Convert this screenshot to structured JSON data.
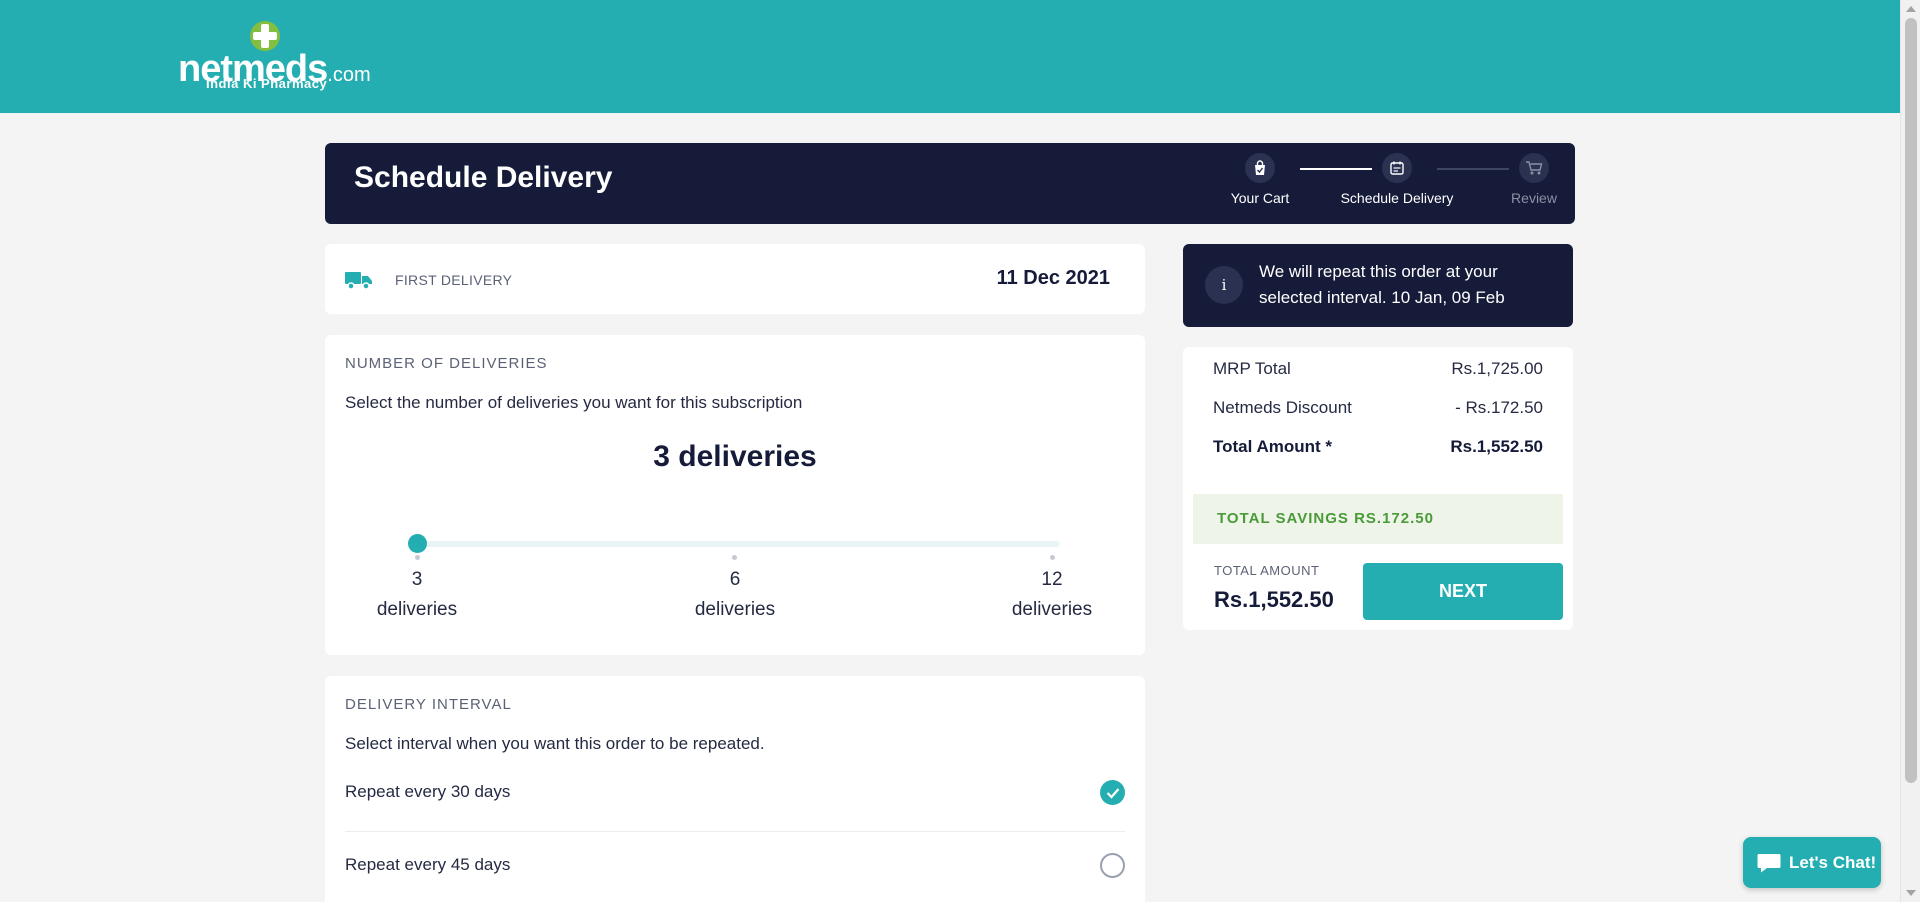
{
  "brand": {
    "logo_text": "netmeds",
    "logo_suffix": ".com",
    "tagline": "India Ki Pharmacy",
    "primary_color": "#24aeb1",
    "dark_color": "#151b39"
  },
  "header": {
    "title": "Schedule Delivery",
    "steps": [
      {
        "label": "Your Cart",
        "icon": "shopping-bag-icon",
        "state": "done"
      },
      {
        "label": "Schedule Delivery",
        "icon": "calendar-icon",
        "state": "active"
      },
      {
        "label": "Review",
        "icon": "cart-icon",
        "state": "pending"
      }
    ]
  },
  "first_delivery": {
    "label": "FIRST DELIVERY",
    "date": "11 Dec 2021",
    "icon": "truck-icon"
  },
  "deliveries": {
    "title": "NUMBER OF DELIVERIES",
    "subtitle": "Select the number of deliveries you want for this subscription",
    "selected": "3 deliveries",
    "options": [
      {
        "count": "3",
        "unit": "deliveries"
      },
      {
        "count": "6",
        "unit": "deliveries"
      },
      {
        "count": "12",
        "unit": "deliveries"
      }
    ],
    "selected_index": 0
  },
  "interval": {
    "title": "DELIVERY INTERVAL",
    "subtitle": "Select interval when you want this order to be repeated.",
    "options": [
      {
        "label": "Repeat every 30 days",
        "selected": true
      },
      {
        "label": "Repeat every 45 days",
        "selected": false
      }
    ]
  },
  "info_banner": {
    "icon": "info-icon",
    "icon_glyph": "i",
    "text": "We will repeat this order at your selected interval. 10 Jan, 09 Feb"
  },
  "summary": {
    "rows": [
      {
        "label": "MRP Total",
        "value": "Rs.1,725.00"
      },
      {
        "label": "Netmeds Discount",
        "value": "- Rs.172.50"
      },
      {
        "label": "Total Amount *",
        "value": "Rs.1,552.50"
      }
    ],
    "savings": "TOTAL SAVINGS RS.172.50",
    "total_label": "TOTAL AMOUNT",
    "total_value": "Rs.1,552.50",
    "next_label": "NEXT"
  },
  "chat": {
    "label": "Let's Chat!",
    "icon": "chat-bubble-icon"
  }
}
